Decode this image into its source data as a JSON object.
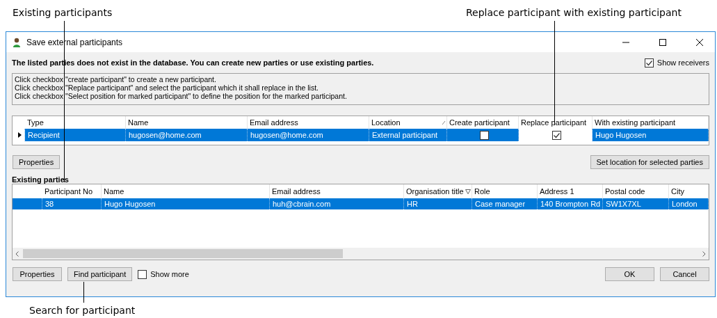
{
  "callouts": [
    {
      "text": "Existing participants"
    },
    {
      "text": "Replace participant with existing participant"
    },
    {
      "text": "Search for participant"
    }
  ],
  "window": {
    "title": "Save external participants"
  },
  "message": "The listed parties does not exist in the database. You can create new parties or use existing parties.",
  "show_receivers": {
    "label": "Show receivers",
    "checked": true
  },
  "instructions": [
    "Click checkbox \"create participant\" to create a new participant.",
    "Click checkbox \"Replace participant\" and select the participant which it shall replace in the list.",
    "Click checkbox \"Select position for marked participant\" to define the position for the marked participant."
  ],
  "recipients_table": {
    "columns": [
      {
        "label": "Type",
        "sorted": false
      },
      {
        "label": "Name",
        "sorted": false
      },
      {
        "label": "Email address",
        "sorted": false
      },
      {
        "label": "Location",
        "sorted": true
      },
      {
        "label": "Create participant",
        "sorted": false
      },
      {
        "label": "Replace participant",
        "sorted": false
      },
      {
        "label": "With existing participant",
        "sorted": false
      }
    ],
    "rows": [
      {
        "selected": true,
        "type": "Recipient",
        "name": "hugosen@home.com",
        "email": "hugosen@home.com",
        "location": "External participant",
        "create_participant": false,
        "replace_participant": true,
        "with_existing": "Hugo Hugosen"
      }
    ]
  },
  "properties_button": "Properties",
  "set_location_button": "Set location for selected parties",
  "existing_parties": {
    "title": "Existing parties",
    "columns": [
      {
        "label": "Participant No",
        "sorted": false
      },
      {
        "label": "Name",
        "sorted": false
      },
      {
        "label": "Email address",
        "sorted": false
      },
      {
        "label": "Organisation title",
        "sorted": true
      },
      {
        "label": "Role",
        "sorted": false
      },
      {
        "label": "Address 1",
        "sorted": false
      },
      {
        "label": "Postal code",
        "sorted": false
      },
      {
        "label": "City",
        "sorted": false
      }
    ],
    "rows": [
      {
        "selected": true,
        "cells": [
          "38",
          "Hugo Hugosen",
          "huh@cbrain.com",
          "HR",
          "Case manager",
          "140 Brompton Rd",
          "SW1X7XL",
          "London"
        ]
      }
    ]
  },
  "footer": {
    "properties_button": "Properties",
    "find_button": "Find participant",
    "show_more": {
      "label": "Show more",
      "checked": false
    },
    "ok_button": "OK",
    "cancel_button": "Cancel"
  }
}
